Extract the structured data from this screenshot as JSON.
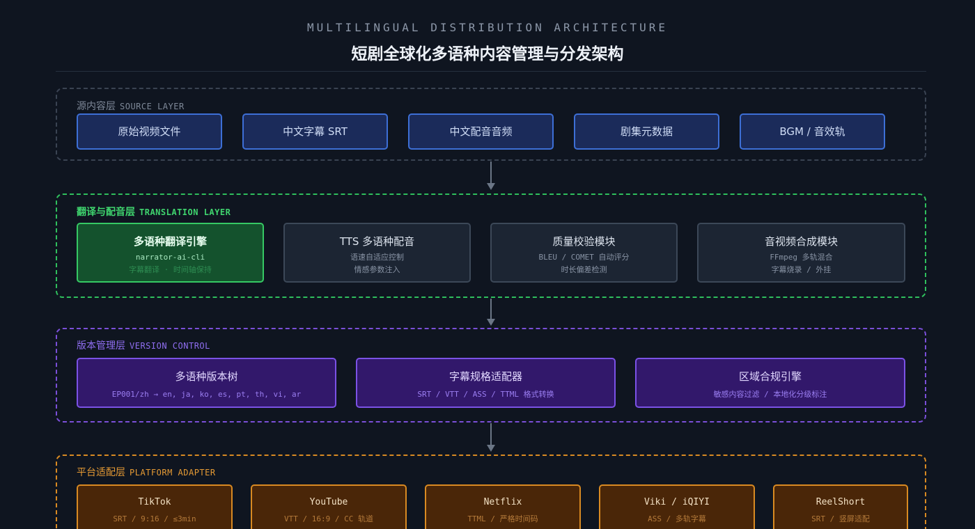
{
  "header": {
    "kicker": "MULTILINGUAL DISTRIBUTION ARCHITECTURE",
    "title": "短剧全球化多语种内容管理与分发架构"
  },
  "source_layer": {
    "label_zh": "源内容层",
    "label_en": "SOURCE LAYER",
    "items": [
      "原始视频文件",
      "中文字幕 SRT",
      "中文配音音频",
      "剧集元数据",
      "BGM / 音效轨"
    ]
  },
  "translation_layer": {
    "label_zh": "翻译与配音层",
    "label_en": "TRANSLATION LAYER",
    "items": [
      {
        "title": "多语种翻译引擎",
        "line1": "narrator-ai-cli",
        "line2": "字幕翻译 · 时间轴保持"
      },
      {
        "title": "TTS 多语种配音",
        "line1": "语速自适应控制",
        "line2": "情感参数注入"
      },
      {
        "title": "质量校验模块",
        "line1": "BLEU / COMET 自动评分",
        "line2": "时长偏差检测"
      },
      {
        "title": "音视频合成模块",
        "line1": "FFmpeg 多轨混合",
        "line2": "字幕烧录 / 外挂"
      }
    ]
  },
  "version_layer": {
    "label_zh": "版本管理层",
    "label_en": "VERSION CONTROL",
    "items": [
      {
        "title": "多语种版本树",
        "line1": "EP001/zh → en, ja, ko, es, pt, th, vi, ar"
      },
      {
        "title": "字幕规格适配器",
        "line1": "SRT / VTT / ASS / TTML 格式转换"
      },
      {
        "title": "区域合规引擎",
        "line1": "敏感内容过滤 / 本地化分级标注"
      }
    ]
  },
  "platform_layer": {
    "label_zh": "平台适配层",
    "label_en": "PLATFORM ADAPTER",
    "items": [
      {
        "title": "TikTok",
        "line1": "SRT / 9:16 / ≤3min"
      },
      {
        "title": "YouTube",
        "line1": "VTT / 16:9 / CC 轨道"
      },
      {
        "title": "Netflix",
        "line1": "TTML / 严格时间码"
      },
      {
        "title": "Viki / iQIYI",
        "line1": "ASS / 多轨字幕"
      },
      {
        "title": "ReelShort",
        "line1": "SRT / 竖屏适配"
      }
    ]
  },
  "colors": {
    "background": "#0f1520",
    "source": "#3d6fd6",
    "translation": "#36c964",
    "version": "#7b52e6",
    "platform": "#d98a22"
  }
}
